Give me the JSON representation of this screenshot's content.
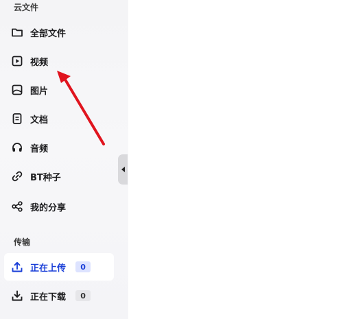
{
  "sidebar": {
    "cloud_section": "云文件",
    "items": [
      {
        "label": "全部文件",
        "icon": "folder-icon"
      },
      {
        "label": "视频",
        "icon": "video-icon"
      },
      {
        "label": "图片",
        "icon": "image-icon"
      },
      {
        "label": "文档",
        "icon": "document-icon"
      },
      {
        "label": "音频",
        "icon": "headphones-icon"
      },
      {
        "label": "BT种子",
        "icon": "link-icon"
      },
      {
        "label": "我的分享",
        "icon": "share-icon"
      }
    ],
    "transfer_section": "传输",
    "transfer_items": [
      {
        "label": "正在上传",
        "icon": "upload-icon",
        "count": "0"
      },
      {
        "label": "正在下载",
        "icon": "download-icon",
        "count": "0"
      }
    ]
  },
  "colors": {
    "accent": "#1a3fd8",
    "annotation_arrow": "#e0141e"
  }
}
